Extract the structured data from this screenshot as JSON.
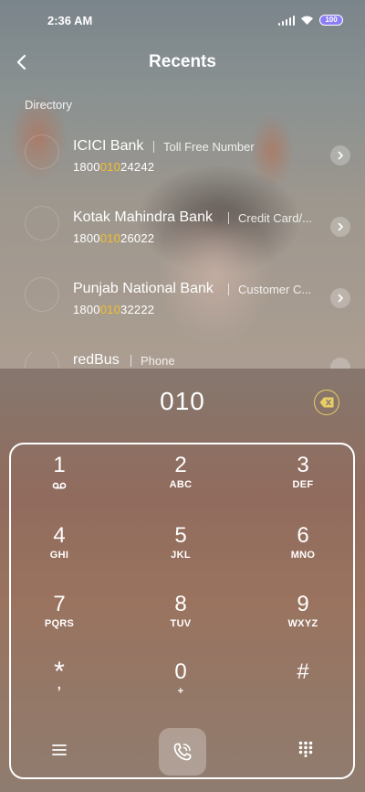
{
  "status_bar": {
    "time": "2:36 AM",
    "battery": "100"
  },
  "header": {
    "title": "Recents",
    "back_icon": "back-arrow-icon"
  },
  "directory": {
    "label": "Directory",
    "results": [
      {
        "name": "ICICI Bank",
        "type": "Toll Free Number",
        "number_prefix": "1800",
        "number_match": "010",
        "number_suffix": "24242"
      },
      {
        "name": "Kotak Mahindra Bank",
        "type": "Credit Card/...",
        "number_prefix": "1800",
        "number_match": "010",
        "number_suffix": "26022"
      },
      {
        "name": "Punjab National Bank",
        "type": "Customer C...",
        "number_prefix": "1800",
        "number_match": "010",
        "number_suffix": "32222"
      },
      {
        "name": "redBus",
        "type": "Phone",
        "number_prefix": "",
        "number_match": "",
        "number_suffix": ""
      }
    ]
  },
  "dialer": {
    "input": "010",
    "keys": [
      {
        "digit": "1",
        "letters": ""
      },
      {
        "digit": "2",
        "letters": "ABC"
      },
      {
        "digit": "3",
        "letters": "DEF"
      },
      {
        "digit": "4",
        "letters": "GHI"
      },
      {
        "digit": "5",
        "letters": "JKL"
      },
      {
        "digit": "6",
        "letters": "MNO"
      },
      {
        "digit": "7",
        "letters": "PQRS"
      },
      {
        "digit": "8",
        "letters": "TUV"
      },
      {
        "digit": "9",
        "letters": "WXYZ"
      },
      {
        "digit": "*",
        "letters": ","
      },
      {
        "digit": "0",
        "letters": "+"
      },
      {
        "digit": "#",
        "letters": ""
      }
    ]
  },
  "colors": {
    "highlight": "#f2c02a",
    "battery": "#8c7cf5",
    "backspace": "#e9cf63"
  }
}
